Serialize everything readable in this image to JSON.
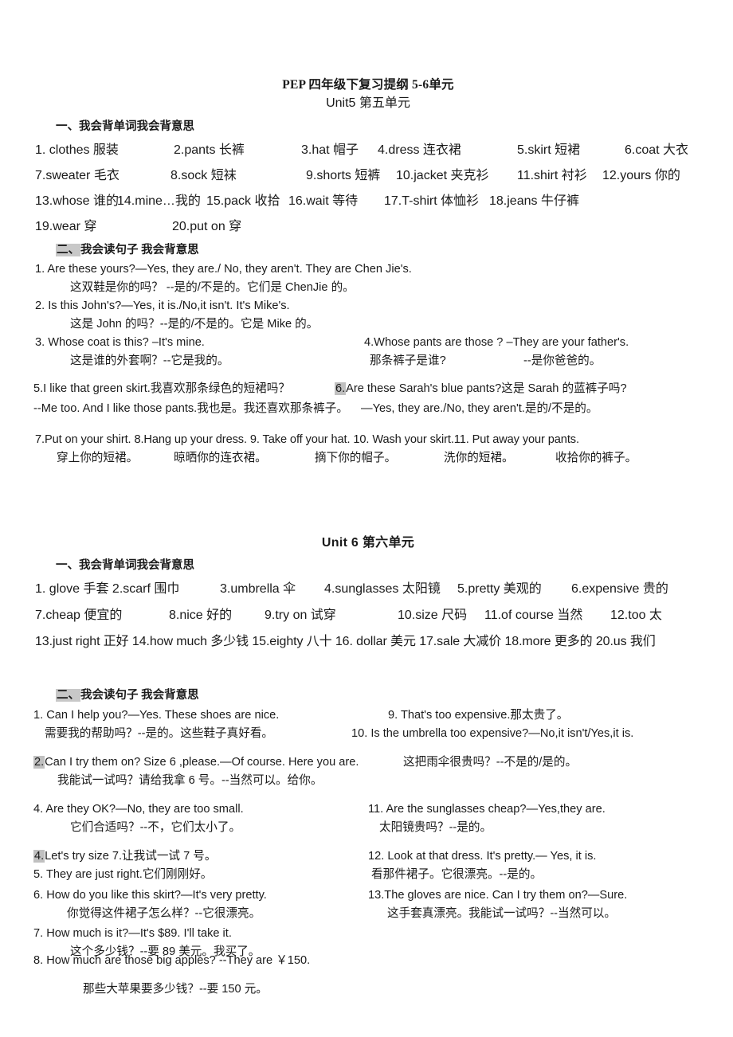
{
  "document": {
    "title": "PEP 四年级下复习提纲 5-6单元",
    "unit5_title": "Unit5 第五单元",
    "unit6_title": "Unit 6 第六单元"
  },
  "unit5": {
    "section1_heading": "一、我会背单词我会背意思",
    "section2_heading_mark": "二、",
    "section2_heading_rest": "我会读句子 我会背意思",
    "words_rows": [
      [
        "1.  clothes 服装",
        "2.pants 长裤",
        "3.hat 帽子",
        "4.dress 连衣裙",
        "5.skirt 短裙",
        "6.coat 大衣"
      ],
      [
        "7.sweater 毛衣",
        "8.sock 短袜",
        "9.shorts 短裤",
        "10.jacket 夹克衫",
        "11.shirt 衬衫",
        "12.yours 你的"
      ],
      [
        "13.whose 谁的",
        "14.mine…我的",
        "15.pack 收拾",
        "16.wait 等待",
        "17.T-shirt 体恤衫",
        "18.jeans 牛仔裤"
      ],
      [
        "19.wear 穿",
        "20.put on 穿"
      ]
    ],
    "sentences": {
      "s1_en": "1.  Are these yours?—Yes, they are./ No, they aren't. They are Chen Jie's.",
      "s1_zh": "这双鞋是你的吗？   --是的/不是的。它们是 ChenJie 的。",
      "s2_en": "2.  Is this John's?—Yes, it is./No,it isn't. It's Mike's.",
      "s2_zh": "这是 John 的吗？--是的/不是的。它是 Mike 的。",
      "s3_en": "3.  Whose coat is this? –It's mine.",
      "s3_zh": "这是谁的外套啊？--它是我的。",
      "s4_en": "4.Whose pants are   those ? –They are your father's.",
      "s4_zh_a": "那条裤子是谁?",
      "s4_zh_b": "--是你爸爸的。",
      "s5_en": "5.I like that green skirt.我喜欢那条绿色的短裙吗？",
      "s6_num": "6.",
      "s6_en": "Are these Sarah's blue pants?这是 Sarah 的蓝裤子吗?",
      "s5_cont": "--Me too. And I like those pants.我也是。我还喜欢那条裤子。",
      "s6_cont": "—Yes, they are./No, they aren't.是的/不是的。",
      "s7_en": "7.Put on your shirt. 8.Hang up your dress. 9. Take off your hat. 10. Wash your skirt.11. Put away your pants.",
      "s7_zh_1": "穿上你的短裙。",
      "s7_zh_2": "晾晒你的连衣裙。",
      "s7_zh_3": "摘下你的帽子。",
      "s7_zh_4": "洗你的短裙。",
      "s7_zh_5": "收拾你的裤子。"
    }
  },
  "unit6": {
    "section1_heading": "一、我会背单词我会背意思",
    "section2_heading_mark": "二、",
    "section2_heading_rest": "我会读句子 我会背意思",
    "words_rows": [
      [
        "1.  glove 手套 2.scarf 围巾",
        "3.umbrella 伞",
        "4.sunglasses 太阳镜",
        "5.pretty 美观的",
        "6.expensive 贵的"
      ],
      [
        "7.cheap 便宜的",
        "8.nice 好的",
        "9.try on 试穿",
        "10.size 尺码",
        "11.of course 当然",
        "12.too 太"
      ],
      [
        "13.just right 正好 14.how much 多少钱 15.eighty 八十 16. dollar 美元 17.sale 大减价 18.more 更多的 20.us 我们"
      ]
    ],
    "left_sentences": [
      {
        "en": "1. Can I help you?—Yes. These shoes are nice.",
        "zh": "需要我的帮助吗？--是的。这些鞋子真好看。"
      },
      {
        "num_hl": "2.",
        "en": "Can I try them on? Size 6 ,please.—Of course. Here you are.",
        "zh": "我能试一试吗？请给我拿 6 号。--当然可以。给你。"
      },
      {
        "en": "4.   Are they OK?—No, they are too small.",
        "zh": "它们合适吗？--不，它们太小了。"
      },
      {
        "num_hl": "4.",
        "en": "Let's try size 7.让我试一试 7 号。",
        "zh": ""
      },
      {
        "en": "5. They are just right.它们刚刚好。",
        "zh": ""
      },
      {
        "en": "6. How do you like this skirt?—It's very pretty.",
        "zh": "你觉得这件裙子怎么样？--它很漂亮。"
      },
      {
        "en": "7. How much is it?—It's $89. I'll take it.",
        "zh": "这个多少钱？--要 89 美元。我买了。"
      },
      {
        "en": "8. How much are those big apples?  --They are  ￥150.",
        "zh": "那些大苹果要多少钱？--要 150 元。"
      }
    ],
    "right_sentences": [
      {
        "en": "9. That's too expensive.那太贵了。"
      },
      {
        "en": "10. Is the umbrella too expensive?—No,it isn't/Yes,it is."
      },
      {
        "en": "这把雨伞很贵吗？--不是的/是的。"
      },
      {
        "en": "11. Are the sunglasses cheap?—Yes,they are.",
        "zh": "太阳镜贵吗？--是的。"
      },
      {
        "en": "12. Look at that dress. It's pretty.— Yes, it is.",
        "zh": "看那件裙子。它很漂亮。--是的。"
      },
      {
        "en": "13.The gloves are nice. Can I try them on?—Sure.",
        "zh": "这手套真漂亮。我能试一试吗？--当然可以。"
      }
    ]
  },
  "colors": {
    "text": "#1a1a1a",
    "highlight": "#c8c8c8",
    "background": "#ffffff"
  }
}
